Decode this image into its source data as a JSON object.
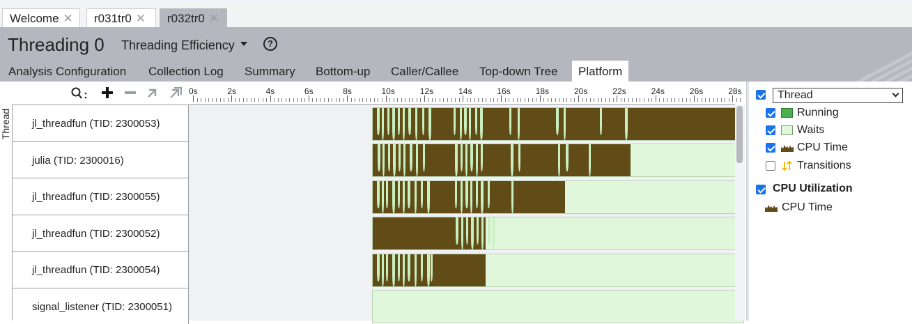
{
  "doc_tabs": [
    {
      "label": "Welcome",
      "close": "✕"
    },
    {
      "label": "r031tr0",
      "close": "✕"
    },
    {
      "label": "r032tr0",
      "close": "✕"
    }
  ],
  "header": {
    "title": "Threading 0",
    "viewpoint": "Threading Efficiency",
    "help_glyph": "?"
  },
  "nav_tabs": [
    "Analysis Configuration",
    "Collection Log",
    "Summary",
    "Bottom-up",
    "Caller/Callee",
    "Top-down Tree",
    "Platform"
  ],
  "active_nav_tab": "Platform",
  "toolbar_icons": [
    "search-icon",
    "zoom-in-icon",
    "zoom-out-icon",
    "undo-zoom-icon",
    "reset-zoom-icon"
  ],
  "thread_axis_label": "Thread",
  "threads": [
    {
      "label": "jl_threadfun (TID: 2300053)",
      "run_until": 28.5
    },
    {
      "label": "julia (TID: 2300016)",
      "run_until": 22.7
    },
    {
      "label": "jl_threadfun (TID: 2300055)",
      "run_until": 19.3
    },
    {
      "label": "jl_threadfun (TID: 2300052)",
      "run_until": 15.2
    },
    {
      "label": "jl_threadfun (TID: 2300054)",
      "run_until": 15.2
    },
    {
      "label": "signal_listener (TID: 2300051)",
      "run_until": null
    }
  ],
  "timeline": {
    "ticks": [
      "0s",
      "2s",
      "4s",
      "6s",
      "8s",
      "10s",
      "12s",
      "14s",
      "16s",
      "18s",
      "20s",
      "22s",
      "24s",
      "26s",
      "28s"
    ],
    "start_s": 9.3,
    "end_s": 28.6
  },
  "legend": {
    "thread_select": "Thread",
    "items": [
      {
        "label": "Running",
        "checked": true,
        "swatch_color": "#4caf50"
      },
      {
        "label": "Waits",
        "checked": true,
        "swatch_color": "#e1f7dc"
      },
      {
        "label": "CPU Time",
        "checked": true,
        "icon": "cpu-time-icon"
      },
      {
        "label": "Transitions",
        "checked": false,
        "icon": "transitions-icon"
      }
    ],
    "cpu_utilization": {
      "label": "CPU Utilization",
      "checked": true,
      "sub_label": "CPU Time"
    }
  },
  "colors": {
    "running_fill": "#614b17",
    "wait_fill": "#e1f7dc",
    "header_bg": "#b4b8be",
    "accent": "#1a73e8"
  }
}
